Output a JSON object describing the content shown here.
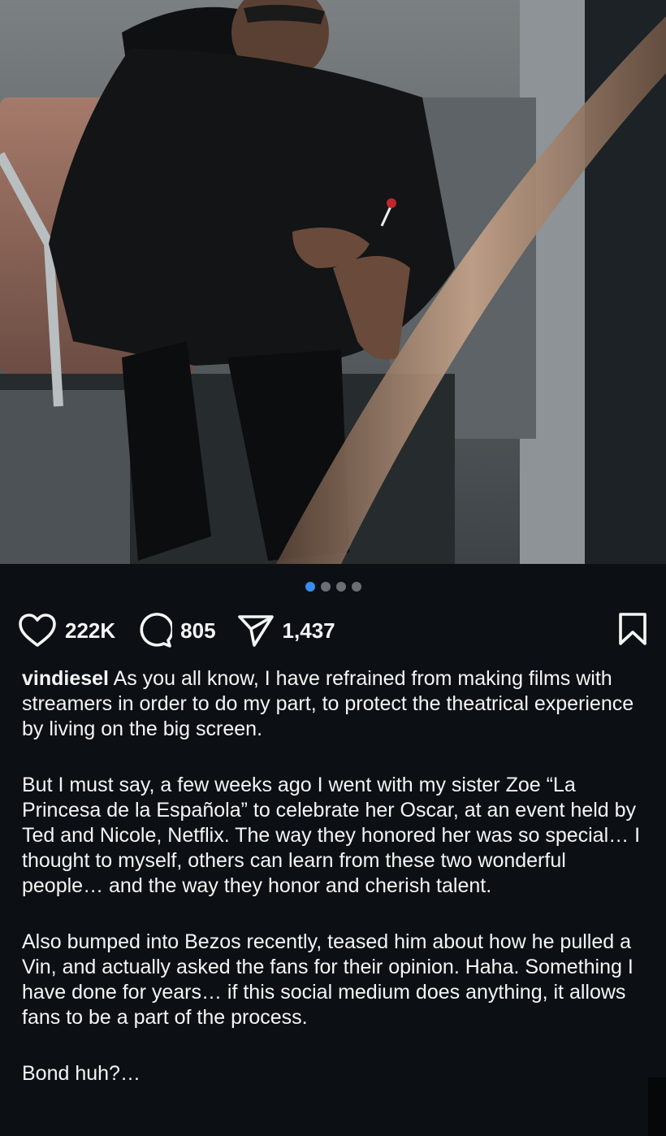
{
  "post": {
    "image_alt": "Man in dark jacket seated on subway train holding a lollipop",
    "carousel": {
      "total": 4,
      "active_index": 0
    },
    "likes": "222K",
    "comments": "805",
    "shares": "1,437"
  },
  "caption": {
    "username": "vindiesel",
    "paragraphs": [
      " As you all know, I have refrained from making films with streamers in order to do my part, to protect the theatrical experience by living on the big screen.",
      "But I must say, a few weeks ago I went with my sister Zoe “La Princesa de la Española” to celebrate her Oscar, at an event held by Ted and Nicole, Netflix. The way they honored her was so special… I thought to myself, others can learn from these two wonderful people… and the way they honor and cherish talent.",
      "Also bumped into Bezos recently, teased him about how he pulled a Vin, and actually asked the fans for their opinion. Haha. Something I have done for years… if this social medium does anything, it allows fans to be a part of the process.",
      "Bond huh?…"
    ]
  },
  "icons": {
    "like": "heart-icon",
    "comment": "comment-bubble-icon",
    "share": "paper-plane-icon",
    "save": "bookmark-icon"
  },
  "colors": {
    "background": "#0c1014",
    "text": "#f5f5f5",
    "active_dot": "#3a8cf0",
    "inactive_dot": "#6b6f74"
  }
}
